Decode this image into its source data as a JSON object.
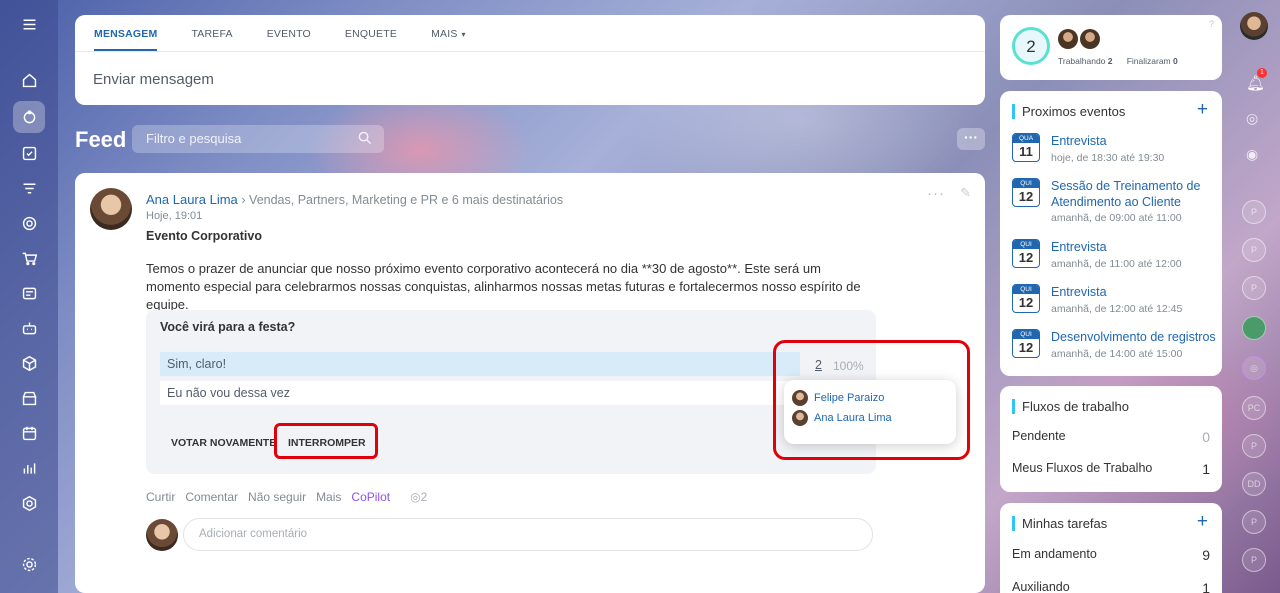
{
  "composer": {
    "tabs": [
      {
        "label": "MENSAGEM"
      },
      {
        "label": "TAREFA"
      },
      {
        "label": "EVENTO"
      },
      {
        "label": "ENQUETE"
      },
      {
        "label": "MAIS"
      }
    ],
    "placeholder": "Enviar mensagem"
  },
  "feed": {
    "title": "Feed",
    "filter_placeholder": "Filtro e pesquisa"
  },
  "post": {
    "author": "Ana Laura Lima",
    "recipients": "Vendas, Partners, Marketing e PR  e 6 mais destinatários",
    "time": "Hoje, 19:01",
    "title": "Evento Corporativo",
    "body": "Temos o prazer de anunciar que nosso próximo evento corporativo acontecerá no dia **30 de agosto**. Este será um momento especial para celebrarmos nossas conquistas, alinharmos nossas metas futuras e fortalecermos nosso espírito de equipe.",
    "poll": {
      "question": "Você virá para a festa?",
      "options": [
        {
          "label": "Sim, claro!",
          "count": "2",
          "percent": "100%"
        },
        {
          "label": "Eu não vou dessa vez"
        }
      ],
      "vote_again": "VOTAR NOVAMENTE",
      "stop": "INTERROMPER",
      "voters": [
        "Felipe Paraizo",
        "Ana Laura Lima"
      ]
    },
    "actions": {
      "like": "Curtir",
      "comment": "Comentar",
      "unfollow": "Não seguir",
      "more": "Mais",
      "copilot": "CoPilot",
      "views": "2"
    },
    "comment_placeholder": "Adicionar comentário"
  },
  "status_widget": {
    "count": "2",
    "working_label": "Trabalhando",
    "working_count": "2",
    "finished_label": "Finalizaram",
    "finished_count": "0"
  },
  "events_widget": {
    "title": "Proximos eventos",
    "events": [
      {
        "dow": "QUA",
        "day": "11",
        "name": "Entrevista",
        "time": "hoje, de 18:30 até 19:30"
      },
      {
        "dow": "QUI",
        "day": "12",
        "name": "Sessão de Treinamento de Atendimento ao Cliente",
        "time": "amanhã, de 09:00 até 11:00"
      },
      {
        "dow": "QUI",
        "day": "12",
        "name": "Entrevista",
        "time": "amanhã, de 11:00 até 12:00"
      },
      {
        "dow": "QUI",
        "day": "12",
        "name": "Entrevista",
        "time": "amanhã, de 12:00 até 12:45"
      },
      {
        "dow": "QUI",
        "day": "12",
        "name": "Desenvolvimento de registros",
        "time": "amanhã, de 14:00 até 15:00"
      }
    ]
  },
  "workflows_widget": {
    "title": "Fluxos de trabalho",
    "rows": [
      {
        "label": "Pendente",
        "value": "0"
      },
      {
        "label": "Meus Fluxos de Trabalho",
        "value": "1"
      }
    ]
  },
  "tasks_widget": {
    "title": "Minhas tarefas",
    "rows": [
      {
        "label": "Em andamento",
        "value": "9"
      },
      {
        "label": "Auxiliando",
        "value": "1"
      }
    ]
  },
  "right_rail": {
    "notification_count": "1",
    "contacts": [
      "P",
      "P",
      "P",
      "PC",
      "P",
      "DD",
      "P",
      "P"
    ]
  },
  "colors": {
    "accent": "#2067b0",
    "highlight": "#e0000a",
    "copilot": "#8e52ec"
  }
}
